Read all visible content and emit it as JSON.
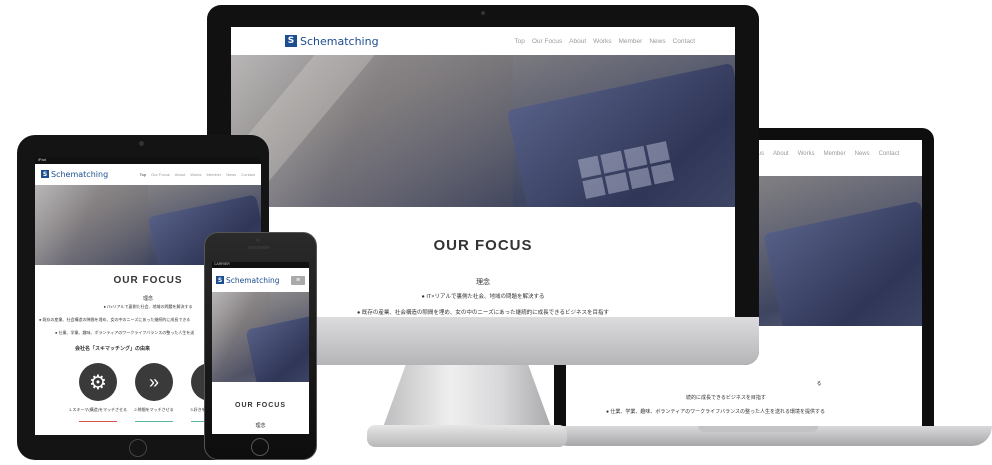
{
  "logo_text": "Schematching",
  "logo_mark": "S",
  "nav_items": [
    "Top",
    "Our Focus",
    "About",
    "Works",
    "Member",
    "News",
    "Contact"
  ],
  "laptop_nav_items": [
    "Our Focus",
    "About",
    "Works",
    "Member",
    "News",
    "Contact"
  ],
  "focus_title": "OUR FOCUS",
  "subtitle": "理念",
  "bullet1": "● IT×リアルで裏側た社会、地域の問題を解決する",
  "bullet2": "● 既存の産業、社会構造の隙間を埋め、女の中のニーズにあった継続的に成長できるビジネスを目指す",
  "bullet3": "● 仕業、学業、趣味、ボランティアのワークライフバランスの整った人生を送れる環境を提供する",
  "tablet": {
    "status_left": "iPad",
    "bullet1": "● ITxリアルで裏側た社会、地域の問題を解決する",
    "bullet2": "● 既存の産業、社会構造の隙間を埋め、女の中のニーズにあった継続的に成長できる",
    "bullet3": "● 仕業、学業、趣味、ボランティアのワークライフバランスの整った人生を送",
    "origin_heading": "会社名「スキマッチング」の由来",
    "icon1_caption": "1.スキーマ(構造)をマッチさせる",
    "icon2_caption": "2.隙間をマッチさせる",
    "icon3_caption": "3.好きをマッチさせる"
  },
  "laptop": {
    "bullet2_tail": "続的に成長できるビジネスを目指す",
    "bullet3": "● 仕業、学業、趣味、ボランティアのワークライフバランスの整った人生を送れる環境を提供する",
    "fragment": "る"
  },
  "phone": {
    "status": "CARRIER",
    "menu_icon": "≡"
  },
  "colors": {
    "brand": "#1d4e8f",
    "accent_green": "#5bb7a3",
    "accent_red": "#d9534f"
  }
}
